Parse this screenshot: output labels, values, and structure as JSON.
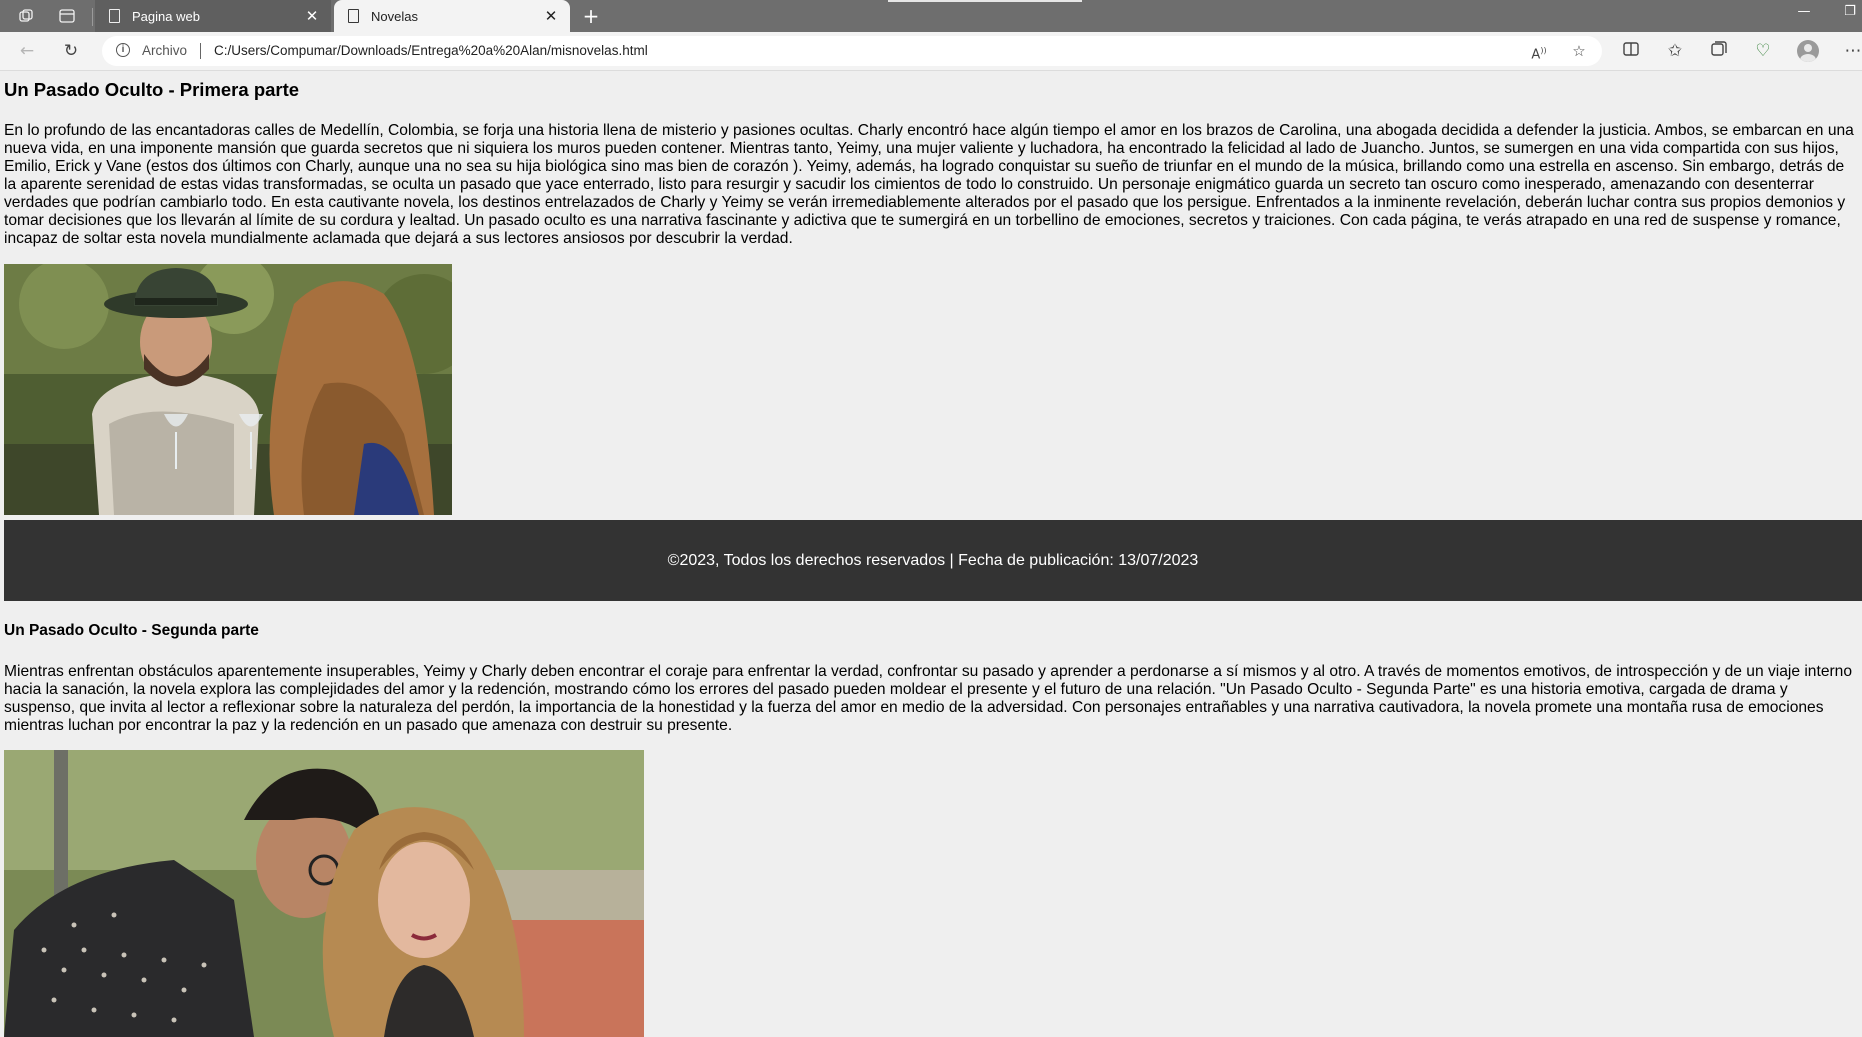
{
  "browser": {
    "tabs": [
      {
        "title": "Pagina web",
        "active": false
      },
      {
        "title": "Novelas",
        "active": true
      }
    ],
    "address": {
      "security_label": "Archivo",
      "url": "C:/Users/Compumar/Downloads/Entrega%20a%20Alan/misnovelas.html"
    },
    "icons": {
      "workspaces": "workspaces-icon",
      "tab_actions": "tab-actions-icon",
      "back": "back-arrow-icon",
      "reload": "reload-icon",
      "read_aloud": "read-aloud-icon",
      "favorite": "star-icon",
      "split_screen": "split-screen-icon",
      "favorites": "favorites-icon",
      "collections": "collections-icon",
      "browser_essentials": "heart-pulse-icon",
      "profile": "avatar",
      "more": "more-icon"
    }
  },
  "page": {
    "section1": {
      "title": "Un Pasado Oculto - Primera parte",
      "text": "En lo profundo de las encantadoras calles de Medellín, Colombia, se forja una historia llena de misterio y pasiones ocultas. Charly encontró hace algún tiempo el amor en los brazos de Carolina, una abogada decidida a defender la justicia. Ambos, se embarcan en una nueva vida, en una imponente mansión que guarda secretos que ni siquiera los muros pueden contener. Mientras tanto, Yeimy, una mujer valiente y luchadora, ha encontrado la felicidad al lado de Juancho. Juntos, se sumergen en una vida compartida con sus hijos, Emilio, Erick y Vane (estos dos últimos con Charly, aunque una no sea su hija biológica sino mas bien de corazón ). Yeimy, además, ha logrado conquistar su sueño de triunfar en el mundo de la música, brillando como una estrella en ascenso. Sin embargo, detrás de la aparente serenidad de estas vidas transformadas, se oculta un pasado que yace enterrado, listo para resurgir y sacudir los cimientos de todo lo construido. Un personaje enigmático guarda un secreto tan oscuro como inesperado, amenazando con desenterrar verdades que podrían cambiarlo todo. En esta cautivante novela, los destinos entrelazados de Charly y Yeimy se verán irremediablemente alterados por el pasado que los persigue. Enfrentados a la inminente revelación, deberán luchar contra sus propios demonios y tomar decisiones que los llevarán al límite de su cordura y lealtad. Un pasado oculto es una narrativa fascinante y adictiva que te sumergirá en un torbellino de emociones, secretos y traiciones. Con cada página, te verás atrapado en una red de suspense y romance, incapaz de soltar esta novela mundialmente aclamada que dejará a sus lectores ansiosos por descubrir la verdad."
    },
    "footer": {
      "text": "©2023, Todos los derechos reservados | Fecha de publicación: 13/07/2023"
    },
    "section2": {
      "title": "Un Pasado Oculto - Segunda parte",
      "text": "Mientras enfrentan obstáculos aparentemente insuperables, Yeimy y Charly deben encontrar el coraje para enfrentar la verdad, confrontar su pasado y aprender a perdonarse a sí mismos y al otro. A través de momentos emotivos, de introspección y de un viaje interno hacia la sanación, la novela explora las complejidades del amor y la redención, mostrando cómo los errores del pasado pueden moldear el presente y el futuro de una relación. \"Un Pasado Oculto - Segunda Parte\" es una historia emotiva, cargada de drama y suspenso, que invita al lector a reflexionar sobre la naturaleza del perdón, la importancia de la honestidad y la fuerza del amor en medio de la adversidad. Con personajes entrañables y una narrativa cautivadora, la novela promete una montaña rusa de emociones mientras luchan por encontrar la paz y la redención en un pasado que amenaza con destruir su presente."
    }
  }
}
